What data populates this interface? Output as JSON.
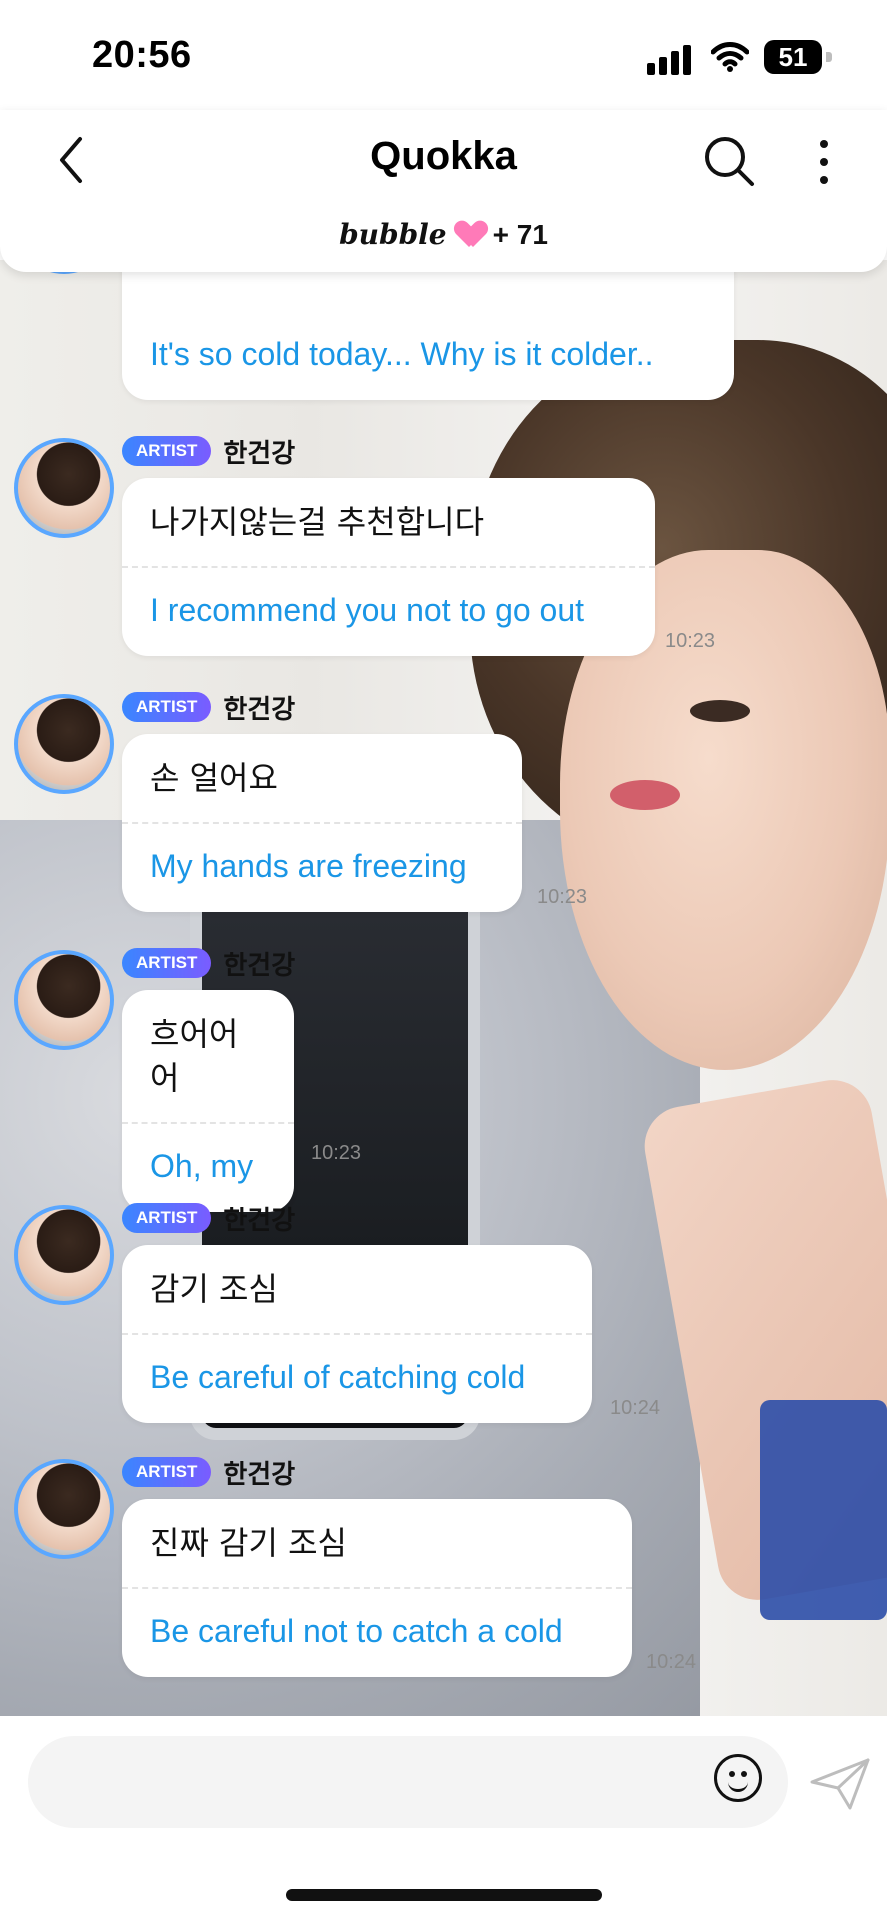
{
  "status": {
    "time": "20:56",
    "battery": "51"
  },
  "header": {
    "title": "Quokka",
    "bubble_brand": "bubble",
    "member_count": "+ 71"
  },
  "messages": [
    {
      "partial": true,
      "en": "It's so cold today... Why is it colder.."
    },
    {
      "badge": "ARTIST",
      "name": "한건강",
      "ko": "나가지않는걸 추천합니다",
      "en": "I recommend you not to go out",
      "time": "10:23"
    },
    {
      "badge": "ARTIST",
      "name": "한건강",
      "ko": "손 얼어요",
      "en": "My hands are freezing",
      "time": "10:23"
    },
    {
      "badge": "ARTIST",
      "name": "한건강",
      "ko": "흐어어어",
      "en": "Oh, my",
      "time": "10:23"
    },
    {
      "badge": "ARTIST",
      "name": "한건강",
      "ko": "감기 조심",
      "en": "Be careful of catching cold",
      "time": "10:24"
    },
    {
      "badge": "ARTIST",
      "name": "한건강",
      "ko": "진짜 감기 조심",
      "en": "Be careful not to catch a cold",
      "time": "10:24"
    }
  ],
  "input": {
    "placeholder": ""
  },
  "icons": {
    "back": "back-chevron-icon",
    "search": "search-icon",
    "more": "more-vertical-icon",
    "emoji": "emoji-icon",
    "send": "send-icon"
  },
  "colors": {
    "translation": "#1a96e6",
    "badge_start": "#3a86ff",
    "badge_end": "#7a5cff",
    "heart": "#ff7ab8"
  }
}
